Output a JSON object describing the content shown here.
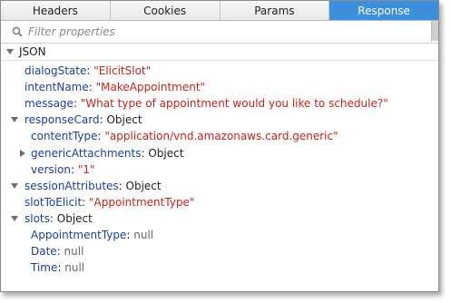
{
  "tabs": [
    {
      "label": "Headers",
      "active": false
    },
    {
      "label": "Cookies",
      "active": false
    },
    {
      "label": "Params",
      "active": false
    },
    {
      "label": "Response",
      "active": true
    }
  ],
  "filter": {
    "placeholder": "Filter properties"
  },
  "section": {
    "label": "JSON"
  },
  "rows": {
    "dialogState": {
      "key": "dialogState",
      "value": "\"ElicitSlot\""
    },
    "intentName": {
      "key": "intentName",
      "value": "\"MakeAppointment\""
    },
    "message": {
      "key": "message",
      "value": "\"What type of appointment would you like to schedule?\""
    },
    "responseCard": {
      "key": "responseCard",
      "value": "Object"
    },
    "contentType": {
      "key": "contentType",
      "value": "\"application/vnd.amazonaws.card.generic\""
    },
    "genericAttachments": {
      "key": "genericAttachments",
      "value": "Object"
    },
    "version": {
      "key": "version",
      "value": "\"1\""
    },
    "sessionAttributes": {
      "key": "sessionAttributes",
      "value": "Object"
    },
    "slotToElicit": {
      "key": "slotToElicit",
      "value": "\"AppointmentType\""
    },
    "slots": {
      "key": "slots",
      "value": "Object"
    },
    "AppointmentType": {
      "key": "AppointmentType",
      "value": "null"
    },
    "Date": {
      "key": "Date",
      "value": "null"
    },
    "Time": {
      "key": "Time",
      "value": "null"
    }
  },
  "colors": {
    "key": "#1a3f9f",
    "string": "#c8211b",
    "active_tab": "#3c8fdc"
  }
}
